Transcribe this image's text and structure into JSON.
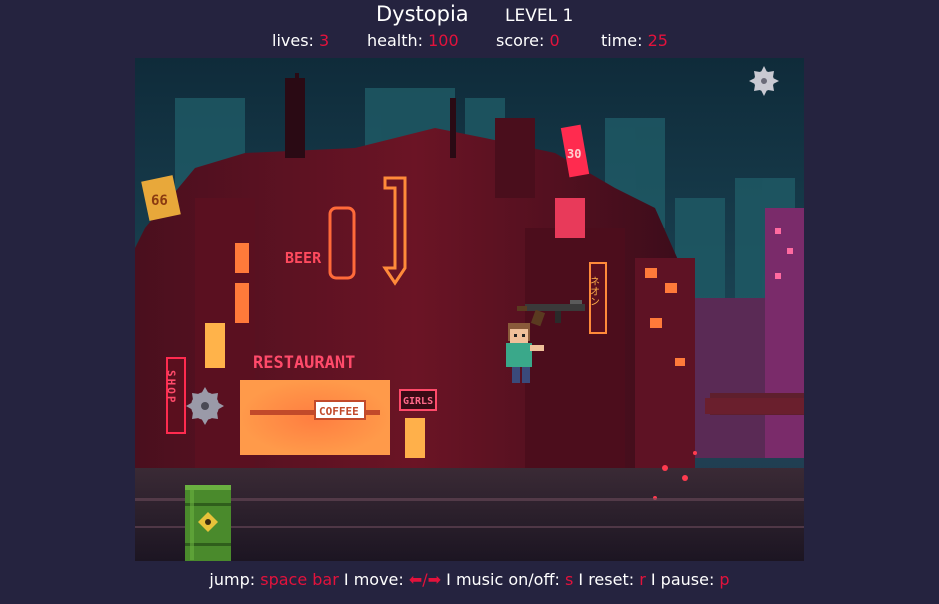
{
  "header": {
    "title": "Dystopia",
    "level": "LEVEL 1"
  },
  "stats": {
    "lives_label": "lives: ",
    "lives_value": "3",
    "health_label": "health: ",
    "health_value": "100",
    "score_label": "score: ",
    "score_value": "0",
    "time_label": "time: ",
    "time_value": "25"
  },
  "scene": {
    "signs": {
      "beer": "BEER",
      "restaurant": "RESTAURANT",
      "coffee": "COFFEE",
      "shop": "SHOP",
      "girls": "GIRLS",
      "badge_66": "66",
      "badge_30": "30",
      "vertical_sign": "ネオン"
    },
    "settings_icon": "gear-icon",
    "saw_icon": "circular-saw-icon",
    "barrel_icon": "biohazard-barrel-icon",
    "weapon_icon": "rifle-icon",
    "player_icon": "player-character",
    "colors": {
      "accent": "#e3123c",
      "background": "#25233f",
      "barrel": "#4a8a2c"
    }
  },
  "footer": {
    "jump_label": "jump: ",
    "jump_key": "space bar",
    "sep1": " I move: ",
    "move_key": "⬅/➡",
    "sep2": " I music on/off: ",
    "music_key": "s",
    "sep3": " I reset: ",
    "reset_key": "r",
    "sep4": " I pause: ",
    "pause_key": "p"
  }
}
